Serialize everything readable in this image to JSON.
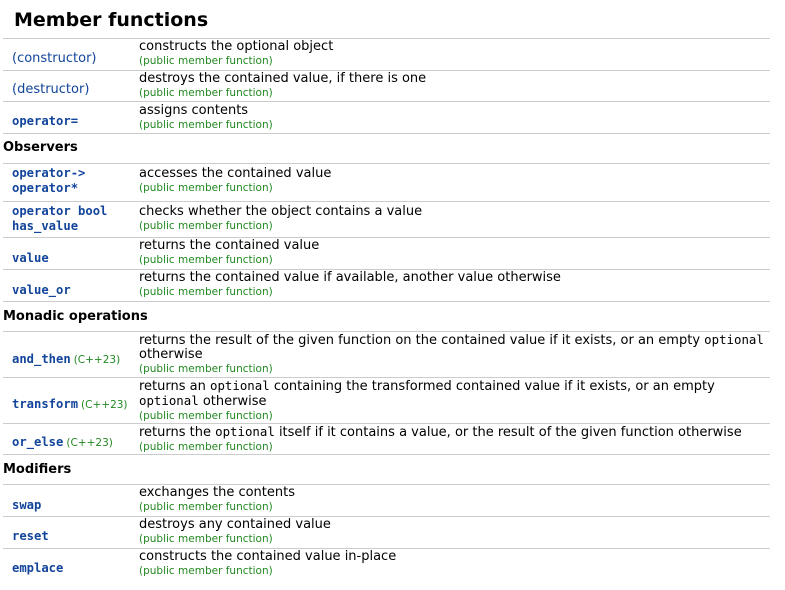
{
  "title": "Member functions",
  "kind_label": "(public member function)",
  "cpp23_label": "(C++23)",
  "sections": {
    "observers": "Observers",
    "monadic": "Monadic operations",
    "modifiers": "Modifiers"
  },
  "rows": {
    "constructor": {
      "name": "(constructor)",
      "desc": "constructs the optional object"
    },
    "destructor": {
      "name": "(destructor)",
      "desc": "destroys the contained value, if there is one"
    },
    "assign": {
      "name": "operator=",
      "desc": "assigns contents"
    },
    "arrow": {
      "name1": "operator->",
      "name2": "operator*",
      "desc": "accesses the contained value"
    },
    "bool": {
      "name1": "operator bool",
      "name2": "has_value",
      "desc": "checks whether the object contains a value"
    },
    "value": {
      "name": "value",
      "desc": "returns the contained value"
    },
    "value_or": {
      "name": "value_or",
      "desc": "returns the contained value if available, another value otherwise"
    },
    "and_then": {
      "name": "and_then",
      "desc_a": "returns the result of the given function on the contained value if it exists, or an empty ",
      "desc_code": "optional",
      "desc_b": "otherwise"
    },
    "transform": {
      "name": "transform",
      "desc_a": "returns an ",
      "desc_code": "optional",
      "desc_b": " containing the transformed contained value if it exists, or an empty",
      "desc_code2": "optional",
      "desc_c": " otherwise"
    },
    "or_else": {
      "name": "or_else",
      "desc_a": "returns the ",
      "desc_code": "optional",
      "desc_b": " itself if it contains a value, or the result of the given function otherwise"
    },
    "swap": {
      "name": "swap",
      "desc": "exchanges the contents"
    },
    "reset": {
      "name": "reset",
      "desc": "destroys any contained value"
    },
    "emplace": {
      "name": "emplace",
      "desc": "constructs the contained value in-place"
    }
  }
}
